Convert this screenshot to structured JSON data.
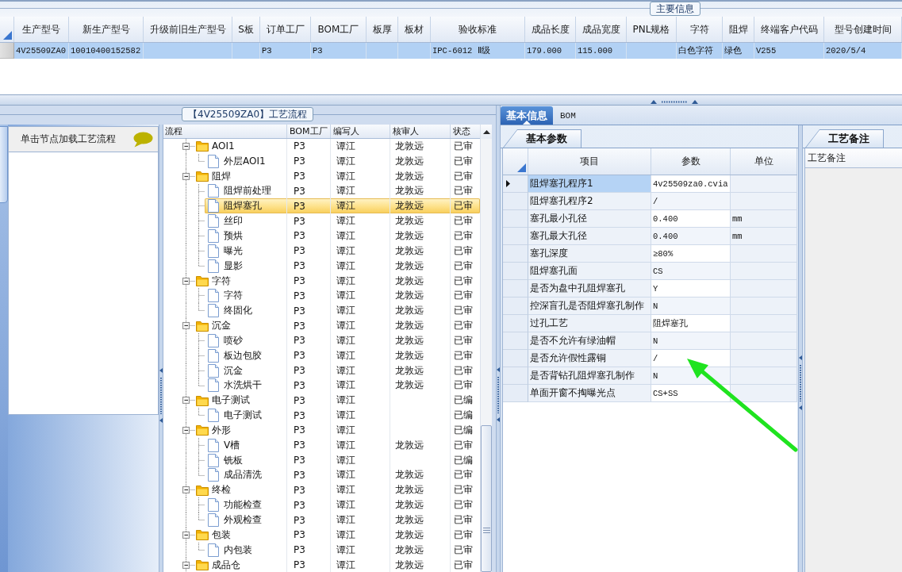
{
  "main_info": {
    "title": "主要信息",
    "columns": [
      "生产型号",
      "新生产型号",
      "升级前旧生产型号",
      "S板",
      "订单工厂",
      "BOM工厂",
      "板厚",
      "板材",
      "验收标准",
      "成品长度",
      "成品宽度",
      "PNL规格",
      "字符",
      "阻焊",
      "终端客户代码",
      "型号创建时间"
    ],
    "rows": [
      {
        "selected": true,
        "cells": [
          "4V25509ZA0",
          "10010400152582",
          null,
          null,
          "P3",
          "P3",
          null,
          null,
          "IPC-6012 Ⅱ级",
          "179.000",
          "115.000",
          null,
          "白色字符",
          "绿色",
          "V255",
          "2020/5/4"
        ]
      }
    ]
  },
  "process_panel": {
    "title": "【4V25509ZA0】工艺流程",
    "hint": "单击节点加载工艺流程",
    "tree": {
      "columns": [
        "流程",
        "BOM工厂",
        "编写人",
        "核审人",
        "状态"
      ],
      "nodes": [
        {
          "label": "AOI1",
          "kind": "folder",
          "expanded": true,
          "selected": false,
          "bom_factory": "P3",
          "writer": "谭江",
          "reviewer": "龙敦远",
          "status": "已审",
          "children": [
            {
              "label": "外层AOI1",
              "kind": "file",
              "selected": false,
              "bom_factory": "P3",
              "writer": "谭江",
              "reviewer": "龙敦远",
              "status": "已审"
            }
          ]
        },
        {
          "label": "阻焊",
          "kind": "folder",
          "expanded": true,
          "selected": false,
          "bom_factory": "P3",
          "writer": "谭江",
          "reviewer": "龙敦远",
          "status": "已审",
          "children": [
            {
              "label": "阻焊前处理",
              "kind": "file",
              "selected": false,
              "bom_factory": "P3",
              "writer": "谭江",
              "reviewer": "龙敦远",
              "status": "已审"
            },
            {
              "label": "阻焊塞孔",
              "kind": "file",
              "selected": true,
              "bom_factory": "P3",
              "writer": "谭江",
              "reviewer": "龙敦远",
              "status": "已审"
            },
            {
              "label": "丝印",
              "kind": "file",
              "selected": false,
              "bom_factory": "P3",
              "writer": "谭江",
              "reviewer": "龙敦远",
              "status": "已审"
            },
            {
              "label": "预烘",
              "kind": "file",
              "selected": false,
              "bom_factory": "P3",
              "writer": "谭江",
              "reviewer": "龙敦远",
              "status": "已审"
            },
            {
              "label": "曝光",
              "kind": "file",
              "selected": false,
              "bom_factory": "P3",
              "writer": "谭江",
              "reviewer": "龙敦远",
              "status": "已审"
            },
            {
              "label": "显影",
              "kind": "file",
              "selected": false,
              "bom_factory": "P3",
              "writer": "谭江",
              "reviewer": "龙敦远",
              "status": "已审"
            }
          ]
        },
        {
          "label": "字符",
          "kind": "folder",
          "expanded": true,
          "selected": false,
          "bom_factory": "P3",
          "writer": "谭江",
          "reviewer": "龙敦远",
          "status": "已审",
          "children": [
            {
              "label": "字符",
              "kind": "file",
              "selected": false,
              "bom_factory": "P3",
              "writer": "谭江",
              "reviewer": "龙敦远",
              "status": "已审"
            },
            {
              "label": "终固化",
              "kind": "file",
              "selected": false,
              "bom_factory": "P3",
              "writer": "谭江",
              "reviewer": "龙敦远",
              "status": "已审"
            }
          ]
        },
        {
          "label": "沉金",
          "kind": "folder",
          "expanded": true,
          "selected": false,
          "bom_factory": "P3",
          "writer": "谭江",
          "reviewer": "龙敦远",
          "status": "已审",
          "children": [
            {
              "label": "喷砂",
              "kind": "file",
              "selected": false,
              "bom_factory": "P3",
              "writer": "谭江",
              "reviewer": "龙敦远",
              "status": "已审"
            },
            {
              "label": "板边包胶",
              "kind": "file",
              "selected": false,
              "bom_factory": "P3",
              "writer": "谭江",
              "reviewer": "龙敦远",
              "status": "已审"
            },
            {
              "label": "沉金",
              "kind": "file",
              "selected": false,
              "bom_factory": "P3",
              "writer": "谭江",
              "reviewer": "龙敦远",
              "status": "已审"
            },
            {
              "label": "水洗烘干",
              "kind": "file",
              "selected": false,
              "bom_factory": "P3",
              "writer": "谭江",
              "reviewer": "龙敦远",
              "status": "已审"
            }
          ]
        },
        {
          "label": "电子测试",
          "kind": "folder",
          "expanded": true,
          "selected": false,
          "bom_factory": "P3",
          "writer": "谭江",
          "status": "已编",
          "children": [
            {
              "label": "电子测试",
              "kind": "file",
              "selected": false,
              "bom_factory": "P3",
              "writer": "谭江",
              "status": "已编"
            }
          ]
        },
        {
          "label": "外形",
          "kind": "folder",
          "expanded": true,
          "selected": false,
          "bom_factory": "P3",
          "writer": "谭江",
          "status": "已编",
          "children": [
            {
              "label": "V槽",
              "kind": "file",
              "selected": false,
              "bom_factory": "P3",
              "writer": "谭江",
              "reviewer": "龙敦远",
              "status": "已审"
            },
            {
              "label": "铣板",
              "kind": "file",
              "selected": false,
              "bom_factory": "P3",
              "writer": "谭江",
              "status": "已编"
            },
            {
              "label": "成品清洗",
              "kind": "file",
              "selected": false,
              "bom_factory": "P3",
              "writer": "谭江",
              "reviewer": "龙敦远",
              "status": "已审"
            }
          ]
        },
        {
          "label": "终检",
          "kind": "folder",
          "expanded": true,
          "selected": false,
          "bom_factory": "P3",
          "writer": "谭江",
          "reviewer": "龙敦远",
          "status": "已审",
          "children": [
            {
              "label": "功能检查",
              "kind": "file",
              "selected": false,
              "bom_factory": "P3",
              "writer": "谭江",
              "reviewer": "龙敦远",
              "status": "已审"
            },
            {
              "label": "外观检查",
              "kind": "file",
              "selected": false,
              "bom_factory": "P3",
              "writer": "谭江",
              "reviewer": "龙敦远",
              "status": "已审"
            }
          ]
        },
        {
          "label": "包装",
          "kind": "folder",
          "expanded": true,
          "selected": false,
          "bom_factory": "P3",
          "writer": "谭江",
          "reviewer": "龙敦远",
          "status": "已审",
          "children": [
            {
              "label": "内包装",
              "kind": "file",
              "selected": false,
              "bom_factory": "P3",
              "writer": "谭江",
              "reviewer": "龙敦远",
              "status": "已审"
            }
          ]
        },
        {
          "label": "成品仓",
          "kind": "folder",
          "expanded": true,
          "selected": false,
          "bom_factory": "P3",
          "writer": "谭江",
          "reviewer": "龙敦远",
          "status": "已审"
        }
      ]
    }
  },
  "detail": {
    "tabs": [
      {
        "label": "基本信息",
        "selected": true
      },
      {
        "label": "BOM",
        "selected": false
      }
    ],
    "params": {
      "tabs": [
        {
          "label": "基本参数",
          "selected": true
        }
      ],
      "columns": [
        "项目",
        "参数",
        "单位"
      ],
      "rows": [
        {
          "item": "阻焊塞孔程序1",
          "value": "4v25509za0.cvia",
          "selected": true
        },
        {
          "item": "阻焊塞孔程序2",
          "value": "/",
          "selected": false
        },
        {
          "item": "塞孔最小孔径",
          "value": "0.400",
          "unit": "mm",
          "selected": false
        },
        {
          "item": "塞孔最大孔径",
          "value": "0.400",
          "unit": "mm",
          "selected": false
        },
        {
          "item": "塞孔深度",
          "value": "≥80%",
          "selected": false
        },
        {
          "item": "阻焊塞孔面",
          "value": "CS",
          "selected": false
        },
        {
          "item": "是否为盘中孔阻焊塞孔",
          "value": "Y",
          "selected": false
        },
        {
          "item": "控深盲孔是否阻焊塞孔制作",
          "value": "N",
          "selected": false
        },
        {
          "item": "过孔工艺",
          "value": "阻焊塞孔",
          "selected": false
        },
        {
          "item": "是否不允许有绿油帽",
          "value": "N",
          "selected": false
        },
        {
          "item": "是否允许假性露铜",
          "value": "/",
          "selected": false
        },
        {
          "item": "是否背钻孔阻焊塞孔制作",
          "value": "N",
          "selected": false
        },
        {
          "item": "单面开窗不掏曝光点",
          "value": "CS+SS",
          "selected": false
        }
      ]
    },
    "notes": {
      "tabs": [
        {
          "label": "工艺备注",
          "selected": true
        }
      ],
      "header": "工艺备注"
    }
  }
}
